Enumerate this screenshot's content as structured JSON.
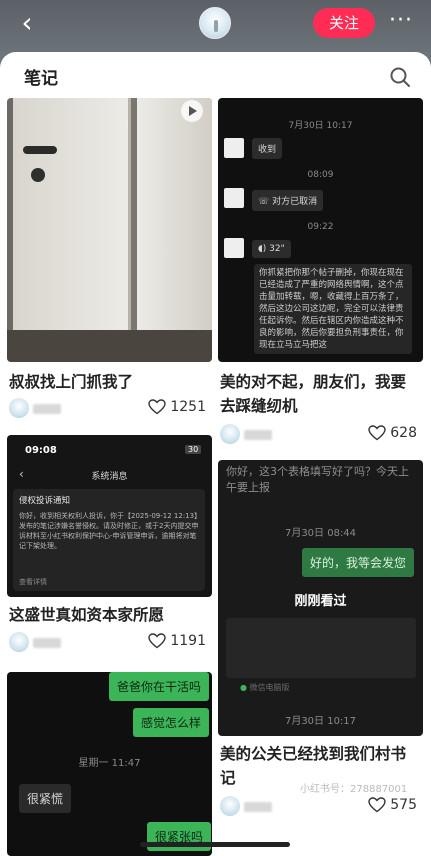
{
  "header": {
    "back": "‹",
    "follow": "关注",
    "more": "···"
  },
  "sheet": {
    "title": "笔记"
  },
  "cards": [
    {
      "title": "叔叔找上门抓我了",
      "likes": "1251"
    },
    {
      "title": "美的对不起，朋友们，我要去踩缝纫机",
      "likes": "628"
    },
    {
      "title": "这盛世真如资本家所愿",
      "likes": "1191"
    },
    {
      "title": "美的公关已经找到我们村书记",
      "likes": "575"
    }
  ],
  "chat2": {
    "time1": "7月30日 10:17",
    "received": "收到",
    "time2": "08:09",
    "cancelled": "对方已取消",
    "time3": "09:22",
    "voice": "32\"",
    "long_text": "你抓紧把你那个帖子删掉，你现在现在已经造成了严重的网络舆情啊，这个点击量加转载，嗯，收藏得上百万条了，然后这边公司这边呢，完全可以法律责任起诉你。然后在辖区内你造成这种不良的影响，然后你要担负刑事责任，你现在立马立马把这"
  },
  "phone3": {
    "clock": "09:08",
    "signal": "30",
    "title": "系统消息",
    "notice_title": "侵权投诉通知",
    "notice_body": "你好，收到相关权利人投诉，你于【2025-09-12 12:13】发布的笔记涉嫌名誉侵权。请及时修正，或于2天内提交申诉材料至小红书权利保护中心-申诉管理申诉，逾期将对笔记下架处理。",
    "detail": "查看详情"
  },
  "chat4": {
    "top_text": "你好，这3个表格填写好了吗？今天上午要上报",
    "time1": "7月30日 08:44",
    "green": "好的，我等会发您",
    "overlay": "刚刚看过",
    "wechat": "微信电脑版",
    "time2": "7月30日 10:17"
  },
  "chat5": {
    "g1": "爸爸你在干活吗",
    "g2": "感觉怎么样",
    "time": "星期一 11:47",
    "dark": "很紧慌",
    "g3": "很紧张吗"
  },
  "watermark": "小红书号：278887001"
}
